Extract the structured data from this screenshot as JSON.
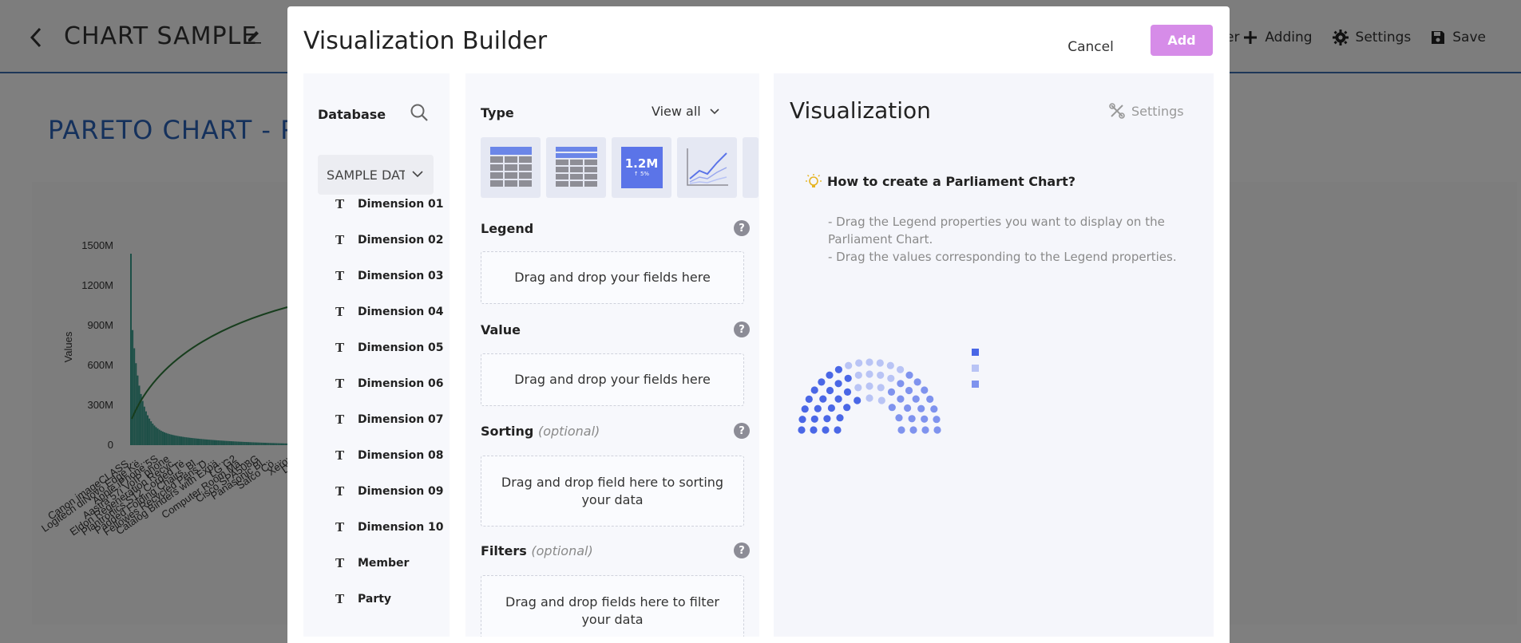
{
  "background": {
    "title": "CHART SAMPLE",
    "pareto_title": "PARETO CHART - PA",
    "actions": {
      "filter_fragment": "er",
      "adding": "Adding",
      "settings": "Settings",
      "save": "Save"
    },
    "chart_data": {
      "type": "bar",
      "ylabel": "Values",
      "y_ticks": [
        "0",
        "300M",
        "600M",
        "900M",
        "1200M",
        "1500M"
      ],
      "categories": [
        "Canon imageCLASS...",
        "Logitech diNovo Edge Ke...",
        "Apple iPhone 5S",
        "Aastra 57i VoIP phone",
        "Eldon Regeneration Recyc...",
        "Plantronics S12 Corded Te...",
        "Padded Folding Chairs, Bl...",
        "Fellowes Recycled Pens D...",
        "Catalog Binders with Expa...",
        "LG G2",
        "Computer Room Ma...",
        "Cisco SPA508G",
        "Panasonic Bl...",
        "Safco Co...",
        "Xerox",
        "Dix..."
      ]
    }
  },
  "modal": {
    "title": "Visualization Builder",
    "cancel": "Cancel",
    "add": "Add"
  },
  "database": {
    "heading": "Database",
    "selected": "SAMPLE DATA",
    "fields": [
      {
        "icon": "T",
        "label": "Dimension 01"
      },
      {
        "icon": "T",
        "label": "Dimension 02"
      },
      {
        "icon": "T",
        "label": "Dimension 03"
      },
      {
        "icon": "T",
        "label": "Dimension 04"
      },
      {
        "icon": "T",
        "label": "Dimension 05"
      },
      {
        "icon": "T",
        "label": "Dimension 06"
      },
      {
        "icon": "T",
        "label": "Dimension 07"
      },
      {
        "icon": "T",
        "label": "Dimension 08"
      },
      {
        "icon": "T",
        "label": "Dimension 09"
      },
      {
        "icon": "T",
        "label": "Dimension 10"
      },
      {
        "icon": "T",
        "label": "Member"
      },
      {
        "icon": "T",
        "label": "Party"
      }
    ]
  },
  "config": {
    "type_label": "Type",
    "view_all": "View all",
    "kpi_value": "1.2M",
    "kpi_delta": "↑ 5%",
    "legend": {
      "title": "Legend",
      "drop": "Drag and drop your fields here"
    },
    "value": {
      "title": "Value",
      "drop": "Drag and drop your fields here"
    },
    "sorting": {
      "title": "Sorting",
      "optional": "(optional)",
      "drop": "Drag and drop field here to sorting your data"
    },
    "filters": {
      "title": "Filters",
      "optional": "(optional)",
      "drop": "Drag and drop fields here to filter your data"
    },
    "help": "?"
  },
  "visualization": {
    "title": "Visualization",
    "settings": "Settings",
    "howto_title": "How to create a Parliament Chart?",
    "howto_lines": [
      "- Drag the Legend properties you want to display on the Parliament Chart.",
      "- Drag the values corresponding to the Legend properties."
    ],
    "colors": {
      "party_a": "#4a67e6",
      "party_b": "#b9c4f5",
      "party_c": "#7f93ee",
      "accent_add": "#d68ce8"
    }
  }
}
